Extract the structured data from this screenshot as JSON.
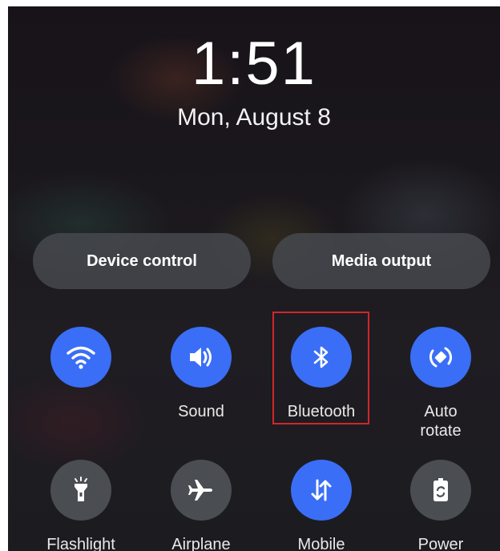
{
  "lockscreen": {
    "time": "1:51",
    "date": "Mon, August 8"
  },
  "pills": {
    "device_control": "Device control",
    "media_output": "Media output"
  },
  "tiles_row1": [
    {
      "label": "",
      "icon": "wifi-icon",
      "state": "on"
    },
    {
      "label": "Sound",
      "icon": "speaker-icon",
      "state": "on"
    },
    {
      "label": "Bluetooth",
      "icon": "bluetooth-icon",
      "state": "on"
    },
    {
      "label_line1": "Auto",
      "label_line2": "rotate",
      "icon": "auto-rotate-icon",
      "state": "on"
    }
  ],
  "tiles_row2": [
    {
      "label": "Flashlight",
      "icon": "flashlight-icon",
      "state": "off"
    },
    {
      "label": "Airplane",
      "icon": "airplane-icon",
      "state": "off"
    },
    {
      "label": "Mobile",
      "icon": "mobile-data-icon",
      "state": "on"
    },
    {
      "label": "Power",
      "icon": "power-saving-icon",
      "state": "off"
    }
  ],
  "colors": {
    "active_tile": "#3a6ef6",
    "inactive_tile": "#4a4d52",
    "highlight_box": "#d0262b"
  }
}
